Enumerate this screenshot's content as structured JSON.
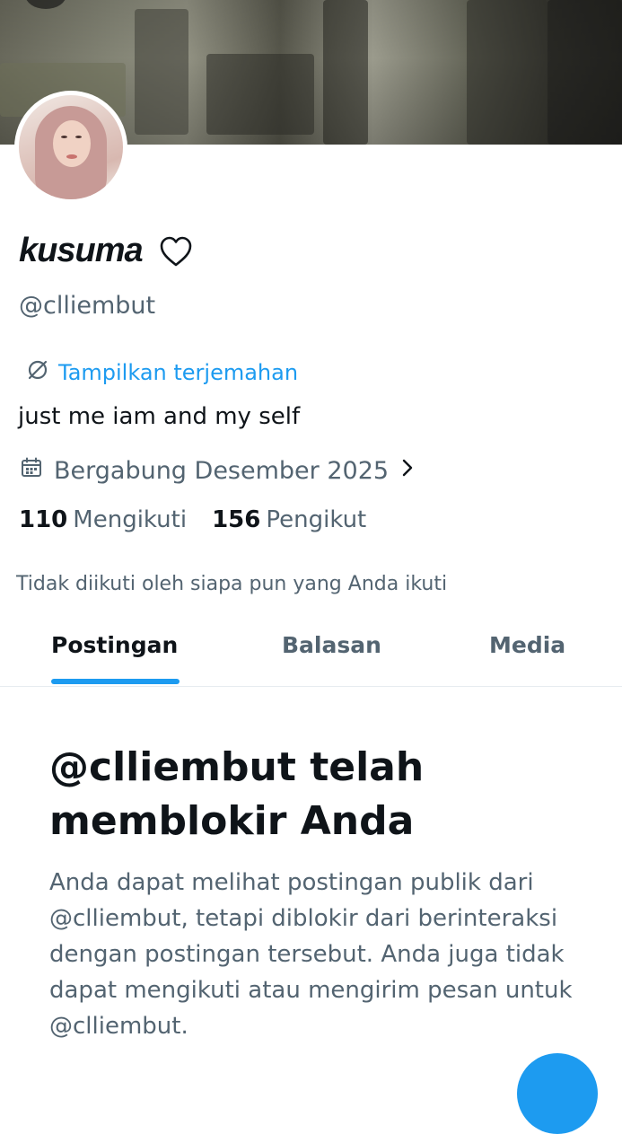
{
  "profile": {
    "display_name": "kusuma",
    "handle": "@clliembut",
    "translate_label": "Tampilkan terjemahan",
    "bio": "just me iam and my self",
    "joined": "Bergabung Desember 2025",
    "following_count": "110",
    "following_label": "Mengikuti",
    "followers_count": "156",
    "followers_label": "Pengikut",
    "not_followed_note": "Tidak diikuti oleh siapa pun yang Anda ikuti"
  },
  "tabs": [
    {
      "label": "Postingan",
      "active": true
    },
    {
      "label": "Balasan",
      "active": false
    },
    {
      "label": "Media",
      "active": false
    }
  ],
  "blocked": {
    "title": "@clliembut telah memblokir Anda",
    "body": "Anda dapat melihat postingan publik dari @clliembut, tetapi diblokir dari berinteraksi dengan postingan tersebut. Anda juga tidak dapat mengikuti atau mengirim pesan untuk @clliembut."
  },
  "icons": {
    "name_suffix": "heart-outline-icon",
    "translate": "translate-icon",
    "joined": "calendar-icon",
    "joined_more": "chevron-right-icon",
    "fab": "compose-icon"
  },
  "colors": {
    "accent": "#1d9bf0",
    "text_primary": "#0f1419",
    "text_secondary": "#536471"
  }
}
